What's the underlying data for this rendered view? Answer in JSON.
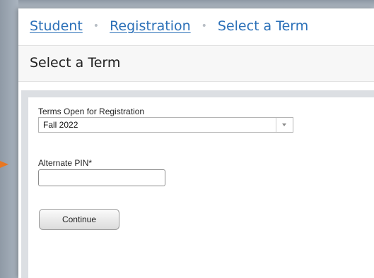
{
  "breadcrumb": {
    "items": [
      {
        "label": "Student"
      },
      {
        "label": "Registration"
      },
      {
        "label": "Select a Term"
      }
    ],
    "separator": "•"
  },
  "page": {
    "title": "Select a Term"
  },
  "form": {
    "term_label": "Terms Open for Registration",
    "term_value": "Fall 2022",
    "pin_label": "Alternate PIN*",
    "pin_value": "",
    "continue_label": "Continue"
  },
  "colors": {
    "link": "#2b70b8",
    "pointer_arrow": "#e87722"
  },
  "icons": {
    "dropdown": "chevron-down-icon",
    "pointer": "arrow-right-icon"
  }
}
